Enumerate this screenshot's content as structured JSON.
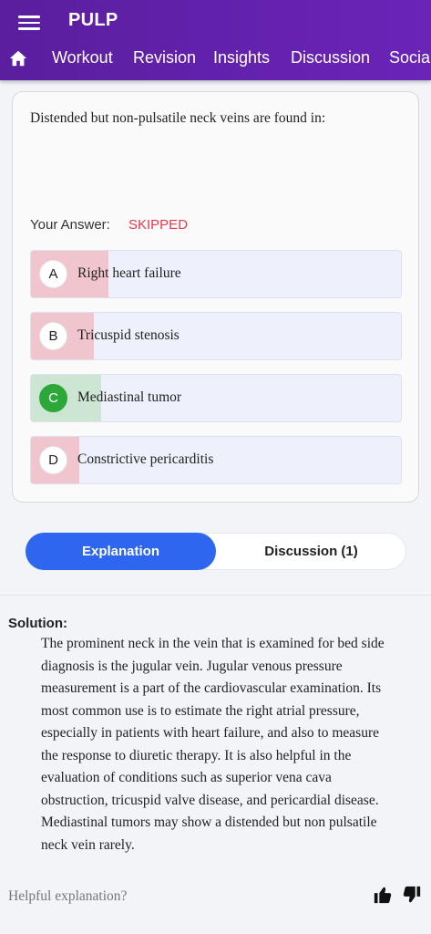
{
  "app": {
    "title": "PULP",
    "nav_tabs": [
      "Workout",
      "Revision",
      "Insights",
      "Discussion",
      "Social"
    ]
  },
  "question": {
    "text": "Distended but non-pulsatile neck veins are found in:",
    "your_answer_label": "Your Answer:",
    "your_answer_value": "SKIPPED",
    "options": [
      {
        "letter": "A",
        "text": "Right heart failure",
        "status": "wrong",
        "response_fraction": 0.21
      },
      {
        "letter": "B",
        "text": "Tricuspid stenosis",
        "status": "wrong",
        "response_fraction": 0.17
      },
      {
        "letter": "C",
        "text": "Mediastinal tumor",
        "status": "correct",
        "response_fraction": 0.19
      },
      {
        "letter": "D",
        "text": "Constrictive pericarditis",
        "status": "wrong",
        "response_fraction": 0.13
      }
    ]
  },
  "toggle": {
    "explanation": "Explanation",
    "discussion": "Discussion (1)"
  },
  "solution": {
    "heading": "Solution:",
    "lines": [
      "The prominent neck in the vein that is examined for bed side",
      "diagnosis is the jugular vein. Jugular venous pressure",
      "measurement is a part of the cardiovascular examination. Its",
      "most common use is to estimate the right atrial pressure,",
      "especially in patients with heart failure, and also to measure",
      "the response to diuretic therapy. It is also helpful in the",
      "evaluation of conditions such as superior vena cava",
      "obstruction, tricuspid valve disease, and pericardial disease.",
      "Mediastinal tumors may show a distended but non pulsatile",
      "neck vein rarely."
    ]
  },
  "feedback": {
    "label": "Helpful explanation?"
  },
  "colors": {
    "header": "#5a1e9e",
    "skipped": "#e53a4d",
    "wrong_bar": "#f0c5cd",
    "correct_bar": "#cce6d3",
    "correct_circle": "#2ca839",
    "active_toggle": "#2f66f0"
  }
}
